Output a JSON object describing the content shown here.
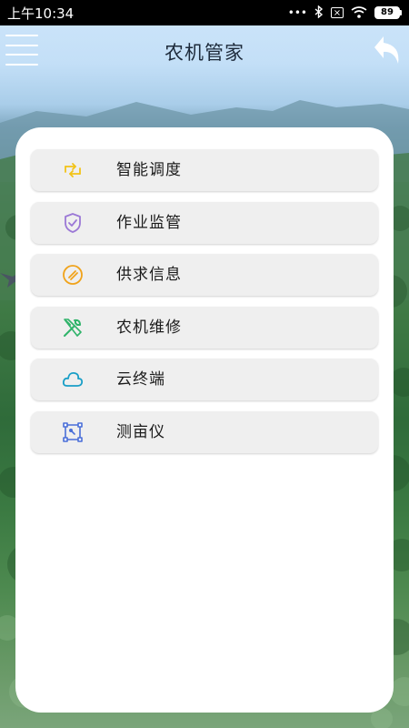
{
  "status_bar": {
    "time": "上午10:34",
    "battery": "89",
    "icons": [
      "dots-icon",
      "bluetooth-icon",
      "sim-icon",
      "wifi-icon",
      "battery-icon"
    ]
  },
  "header": {
    "title": "农机管家",
    "menu_icon": "hamburger-menu-icon",
    "back_icon": "back-arrow-icon"
  },
  "menu": {
    "items": [
      {
        "label": "智能调度",
        "icon": "dispatch-icon",
        "color": "#f2c318"
      },
      {
        "label": "作业监管",
        "icon": "shield-check-icon",
        "color": "#9b78d6"
      },
      {
        "label": "供求信息",
        "icon": "exchange-circle-icon",
        "color": "#f0a31b"
      },
      {
        "label": "农机维修",
        "icon": "wrench-screwdriver-icon",
        "color": "#2fb36a"
      },
      {
        "label": "云终端",
        "icon": "cloud-icon",
        "color": "#1a9fc7"
      },
      {
        "label": "测亩仪",
        "icon": "area-measure-icon",
        "color": "#4a6fd8"
      }
    ]
  },
  "colors": {
    "card_background": "#ffffff",
    "item_background": "#efefef",
    "title_text": "#1d2a3a"
  }
}
